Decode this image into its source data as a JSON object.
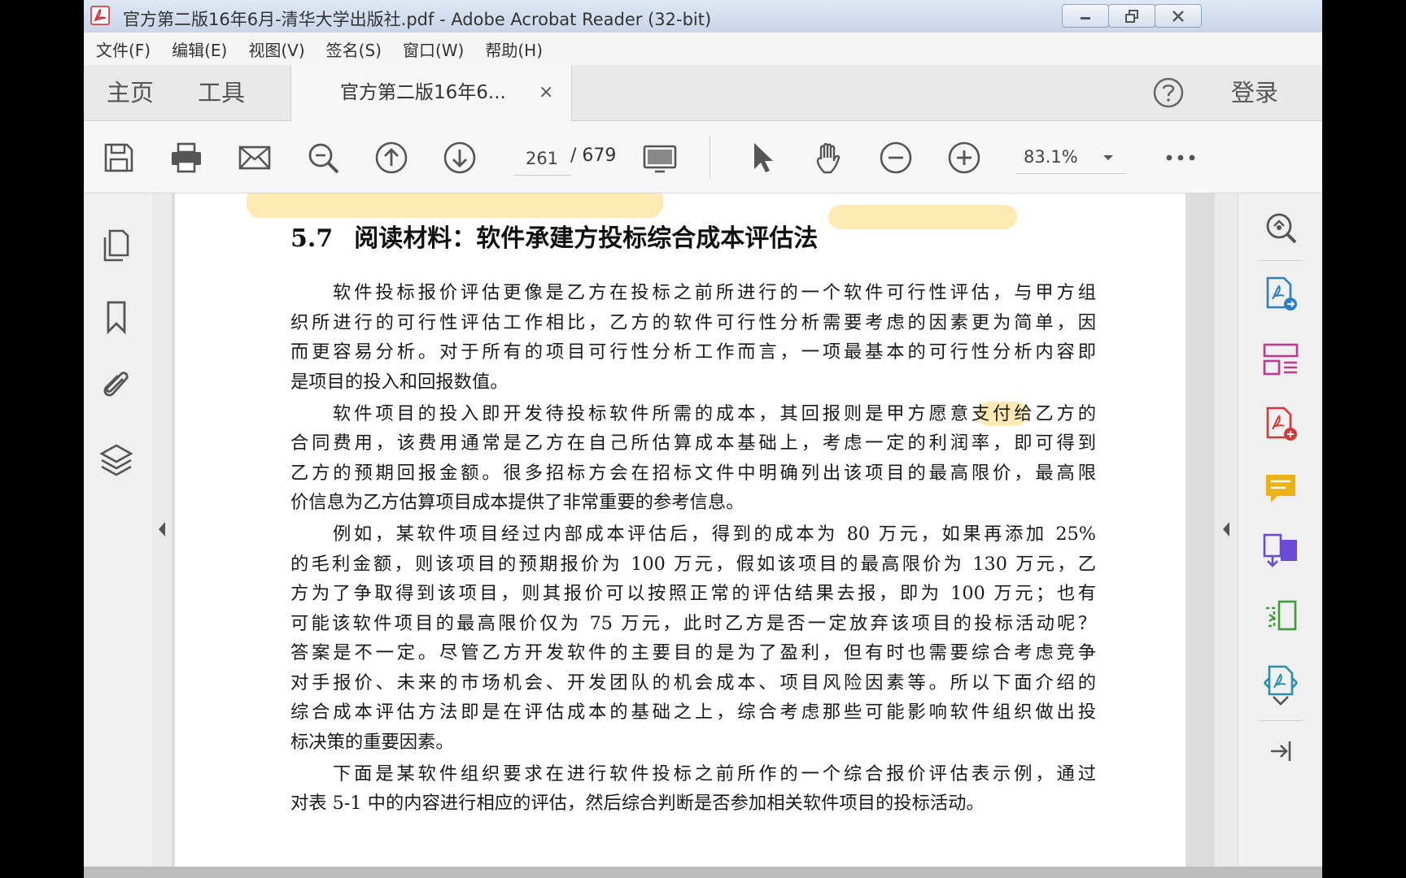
{
  "window": {
    "title": "官方第二版16年6月-清华大学出版社.pdf - Adobe Acrobat Reader (32-bit)"
  },
  "menu": [
    "文件(F)",
    "编辑(E)",
    "视图(V)",
    "签名(S)",
    "窗口(W)",
    "帮助(H)"
  ],
  "tabs": {
    "home": "主页",
    "tools": "工具",
    "document": "官方第二版16年6...",
    "close": "×",
    "login": "登录"
  },
  "toolbar": {
    "page_current": "261",
    "page_total": "/ 679",
    "zoom": "83.1%"
  },
  "document": {
    "heading_num": "5.7",
    "heading_text": "阅读材料：软件承建方投标综合成本评估法",
    "paragraphs": [
      [
        "软件投标报价评估更像是乙方在投标之前所进行的一个软件可行性评估，与甲方组",
        "织所进行的可行性评估工作相比，乙方的软件可行性分析需要考虑的因素更为简单，因",
        "而更容易分析。对于所有的项目可行性分析工作而言，一项最基本的可行性分析内容即",
        "是项目的投入和回报数值。"
      ],
      [
        "软件项目的投入即开发待投标软件所需的成本，其回报则是甲方愿意支付给乙方的",
        "合同费用，该费用通常是乙方在自己所估算成本基础上，考虑一定的利润率，即可得到",
        "乙方的预期回报金额。很多招标方会在招标文件中明确列出该项目的最高限价，最高限",
        "价信息为乙方估算项目成本提供了非常重要的参考信息。"
      ],
      [
        "例如，某软件项目经过内部成本评估后，得到的成本为 80 万元，如果再添加 25%",
        "的毛利金额，则该项目的预期报价为 100 万元，假如该项目的最高限价为 130 万元，乙",
        "方为了争取得到该项目，则其报价可以按照正常的评估结果去报，即为 100 万元；也有",
        "可能该软件项目的最高限价仅为 75 万元，此时乙方是否一定放弃该项目的投标活动呢？",
        "答案是不一定。尽管乙方开发软件的主要目的是为了盈利，但有时也需要综合考虑竞争",
        "对手报价、未来的市场机会、开发团队的机会成本、项目风险因素等。所以下面介绍的",
        "综合成本评估方法即是在评估成本的基础之上，综合考虑那些可能影响软件组织做出投",
        "标决策的重要因素。"
      ],
      [
        "下面是某软件组织要求在进行软件投标之前所作的一个综合报价评估表示例，通过",
        "对表 5-1 中的内容进行相应的评估，然后综合判断是否参加相关软件项目的投标活动。"
      ]
    ]
  },
  "colors": {
    "highlight": "#ffe6a6",
    "tool_create": "#2d7fc1",
    "tool_organize": "#c2378f",
    "tool_export": "#d13a3a",
    "tool_comment": "#e8b317",
    "tool_combine": "#6b4ad6",
    "tool_compress": "#3f9d3f",
    "tool_protect": "#2a8fa8"
  }
}
